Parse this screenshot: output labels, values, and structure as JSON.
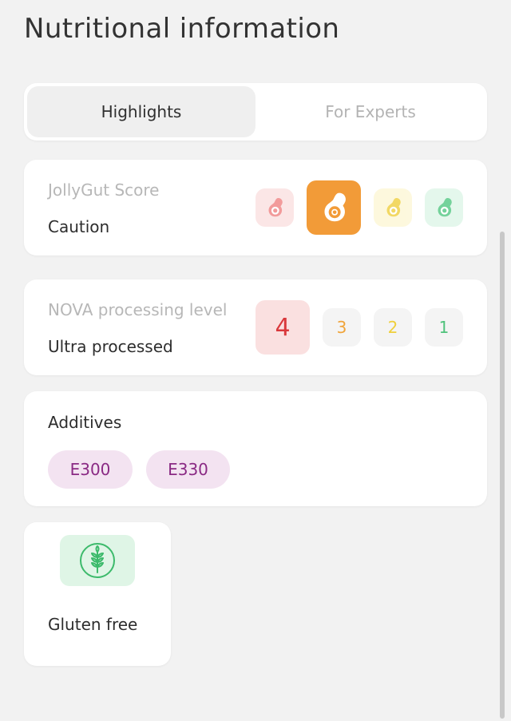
{
  "page": {
    "title": "Nutritional information"
  },
  "tabs": [
    {
      "label": "Highlights",
      "active": true
    },
    {
      "label": "For Experts",
      "active": false
    }
  ],
  "score": {
    "heading": "JollyGut Score",
    "value": "Caution",
    "levels": [
      {
        "name": "red-avocado",
        "color": "#f08a8a",
        "bg": "#fbe2e2",
        "selected": false
      },
      {
        "name": "orange-avocado",
        "color": "#f29b38",
        "bg": "#f29b38",
        "selected": true
      },
      {
        "name": "yellow-avocado",
        "color": "#f0d24a",
        "bg": "#fdf7d8",
        "selected": false
      },
      {
        "name": "green-avocado",
        "color": "#5ccb8a",
        "bg": "#e0f6e9",
        "selected": false
      }
    ]
  },
  "nova": {
    "heading": "NOVA processing level",
    "value": "Ultra processed",
    "levels": [
      {
        "label": "4",
        "color": "#d9383c",
        "bg": "#fae0e0",
        "selected": true
      },
      {
        "label": "3",
        "color": "#f0a43a",
        "bg": "#f4f4f4",
        "selected": false
      },
      {
        "label": "2",
        "color": "#efcf3b",
        "bg": "#f4f4f4",
        "selected": false
      },
      {
        "label": "1",
        "color": "#4fc27b",
        "bg": "#f4f4f4",
        "selected": false
      }
    ]
  },
  "additives": {
    "heading": "Additives",
    "items": [
      "E300",
      "E330"
    ]
  },
  "badges": [
    {
      "label": "Gluten free",
      "icon": "wheat-icon",
      "color": "#3cba6b"
    }
  ]
}
